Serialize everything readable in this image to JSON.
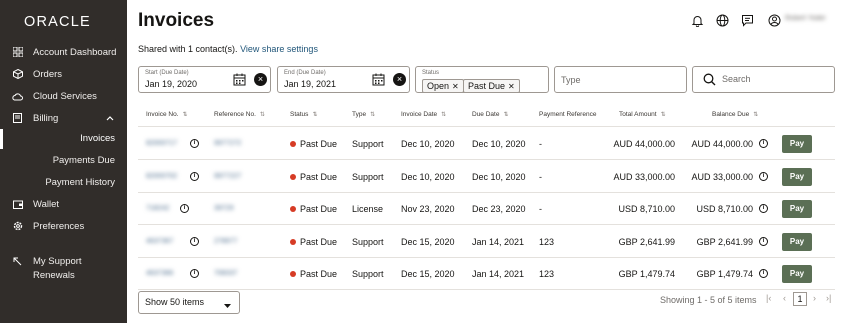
{
  "app": {
    "brand": "ORACLE",
    "title": "Invoices",
    "user_name": "Robert Yoder"
  },
  "sidebar": {
    "items": [
      {
        "label": "Account Dashboard",
        "icon": "grid-icon"
      },
      {
        "label": "Orders",
        "icon": "box-icon"
      },
      {
        "label": "Cloud Services",
        "icon": "cloud-icon"
      },
      {
        "label": "Billing",
        "icon": "receipt-icon"
      },
      {
        "label": "Wallet",
        "icon": "wallet-icon"
      },
      {
        "label": "Preferences",
        "icon": "gear-icon"
      },
      {
        "label": "My Support Renewals",
        "label_line1": "My Support",
        "label_line2": "Renewals",
        "icon": "arrow-upleft-icon"
      }
    ],
    "billing_sub": [
      {
        "label": "Invoices",
        "active": true
      },
      {
        "label": "Payments Due"
      },
      {
        "label": "Payment History"
      }
    ]
  },
  "header": {
    "icons": [
      "bell-icon",
      "globe-icon",
      "chat-icon",
      "user-icon"
    ]
  },
  "shared": {
    "text": "Shared with 1 contact(s).",
    "link": "View share settings"
  },
  "filters": {
    "start": {
      "label": "Start (Due Date)",
      "value": "Jan 19, 2020"
    },
    "end": {
      "label": "End (Due Date)",
      "value": "Jan 19, 2021"
    },
    "status": {
      "label": "Status",
      "chips": [
        "Open",
        "Past Due"
      ]
    },
    "type": {
      "placeholder": "Type"
    },
    "search": {
      "placeholder": "Search"
    }
  },
  "table": {
    "columns": [
      "Invoice No.",
      "Reference No.",
      "Status",
      "Type",
      "Invoice Date",
      "Due Date",
      "Payment Reference",
      "Total Amount",
      "Balance Due"
    ],
    "pay_label": "Pay",
    "rows": [
      {
        "invoice_no": "82000717",
        "reference_no": "9977272",
        "status": "Past Due",
        "type": "Support",
        "invoice_date": "Dec 10, 2020",
        "due_date": "Dec 10, 2020",
        "payment_reference": "-",
        "total": "AUD 44,000.00",
        "balance": "AUD 44,000.00"
      },
      {
        "invoice_no": "82000702",
        "reference_no": "9977227",
        "status": "Past Due",
        "type": "Support",
        "invoice_date": "Dec 10, 2020",
        "due_date": "Dec 10, 2020",
        "payment_reference": "-",
        "total": "AUD 33,000.00",
        "balance": "AUD 33,000.00"
      },
      {
        "invoice_no": "718242",
        "reference_no": "39729",
        "status": "Past Due",
        "type": "License",
        "invoice_date": "Nov 23, 2020",
        "due_date": "Dec 23, 2020",
        "payment_reference": "-",
        "total": "USD 8,710.00",
        "balance": "USD 8,710.00"
      },
      {
        "invoice_no": "4637367",
        "reference_no": "278977",
        "status": "Past Due",
        "type": "Support",
        "invoice_date": "Dec 15, 2020",
        "due_date": "Jan 14, 2021",
        "payment_reference": "123",
        "total": "GBP 2,641.99",
        "balance": "GBP 2,641.99"
      },
      {
        "invoice_no": "4637366",
        "reference_no": "708337",
        "status": "Past Due",
        "type": "Support",
        "invoice_date": "Dec 15, 2020",
        "due_date": "Jan 14, 2021",
        "payment_reference": "123",
        "total": "GBP 1,479.74",
        "balance": "GBP 1,479.74"
      }
    ]
  },
  "footer": {
    "page_size": "Show 50 items",
    "showing": "Showing 1 - 5 of 5 items",
    "current_page": "1"
  },
  "colors": {
    "sidebar_bg": "#312d2a",
    "pay_button": "#5b6f55",
    "past_due_dot": "#d63b25",
    "link": "#22577a"
  }
}
